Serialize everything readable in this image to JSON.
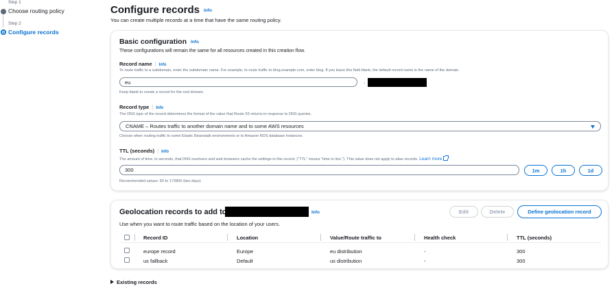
{
  "steps": [
    {
      "label": "Step 1",
      "title": "Choose routing policy"
    },
    {
      "label": "Step 2",
      "title": "Configure records"
    }
  ],
  "page": {
    "title": "Configure records",
    "info": "Info",
    "description": "You can create multiple records at a time that have the same routing policy."
  },
  "basic": {
    "title": "Basic configuration",
    "info": "Info",
    "description": "These configurations will remain the same for all resources created in this creation flow.",
    "record_name": {
      "label": "Record name",
      "info": "Info",
      "description": "To route traffic to a subdomain, enter the subdomain name. For example, to route traffic to blog.example.com, enter blog. If you leave this field blank, the default record name is the name of the domain.",
      "value": "eu",
      "suffix_dot": ".",
      "hint": "Keep blank to create a record for the root domain."
    },
    "record_type": {
      "label": "Record type",
      "info": "Info",
      "description": "The DNS type of the record determines the format of the value that Route 53 returns in response to DNS queries.",
      "value": "CNAME – Routes traffic to another domain name and to some AWS resources",
      "hint": "Choose when routing traffic to some Elastic Beanstalk environments or to Amazon RDS database instances."
    },
    "ttl": {
      "label": "TTL (seconds)",
      "info": "Info",
      "description": "The amount of time, in seconds, that DNS resolvers and web browsers cache the settings in this record. (\"TTL\" means \"time to live.\"). This value does not apply to alias records.",
      "learn_more": "Learn more",
      "value": "300",
      "buttons": [
        "1m",
        "1h",
        "1d"
      ],
      "hint": "Recommended values: 60 to 172800 (two days)"
    }
  },
  "geo": {
    "title": "Geolocation records to add to",
    "info": "Info",
    "description": "Use when you want to route traffic based on the location of your users.",
    "edit_label": "Edit",
    "delete_label": "Delete",
    "define_label": "Define geolocation record",
    "columns": [
      "Record ID",
      "Location",
      "Value/Route traffic to",
      "Health check",
      "TTL (seconds)"
    ],
    "rows": [
      {
        "id": "europe record",
        "location": "Europe",
        "value": "eu distribution",
        "health": "-",
        "ttl": "300"
      },
      {
        "id": "us fallback",
        "location": "Default",
        "value": "us distribution",
        "health": "-",
        "ttl": "300"
      }
    ]
  },
  "existing": {
    "label": "Existing records"
  },
  "colors": {
    "accent": "#0972d3",
    "text": "#16191f",
    "muted": "#5f6b7a",
    "border": "#7d8998"
  }
}
